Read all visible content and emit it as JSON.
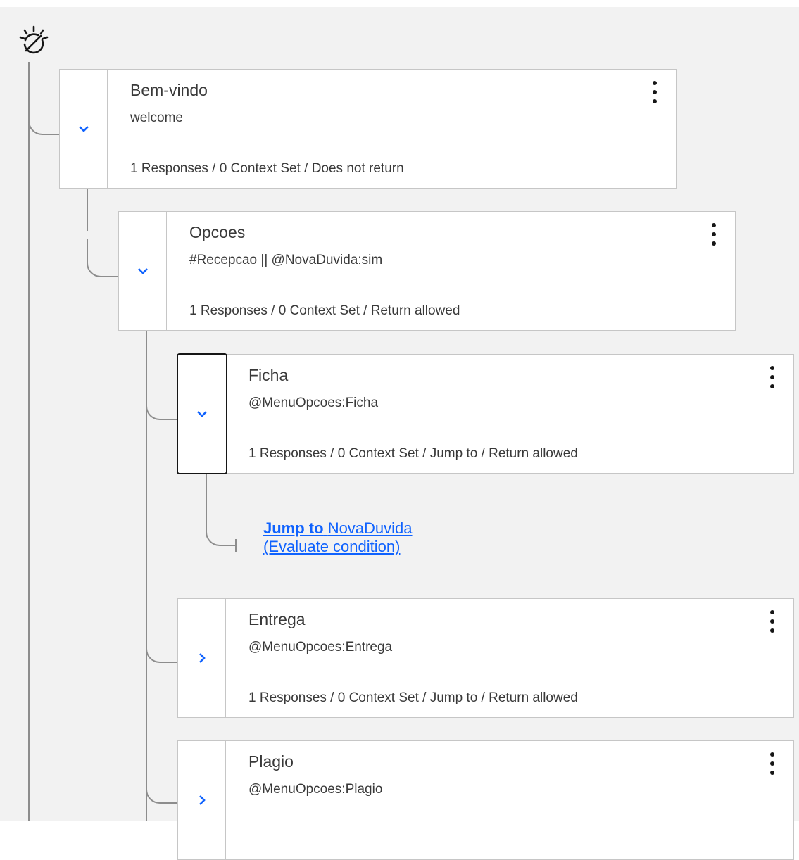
{
  "logo": {
    "icon": "watson-assistant-logo-icon"
  },
  "icons": {
    "expanded": "chevron-down-icon",
    "collapsed": "chevron-right-icon",
    "menu": "overflow-menu-icon"
  },
  "colors": {
    "accent": "#0f62fe",
    "connector": "#8d8d8d",
    "background": "#f2f2f2"
  },
  "nodes": [
    {
      "title": "Bem-vindo",
      "condition": "welcome",
      "summary": "1 Responses / 0 Context Set / Does not return",
      "expanded": true
    },
    {
      "title": "Opcoes",
      "condition": "#Recepcao || @NovaDuvida:sim",
      "summary": "1 Responses / 0 Context Set / Return allowed",
      "expanded": true
    },
    {
      "title": "Ficha",
      "condition": "@MenuOpcoes:Ficha",
      "summary": "1 Responses / 0 Context Set / Jump to / Return allowed",
      "expanded": true
    },
    {
      "title": "Entrega",
      "condition": "@MenuOpcoes:Entrega",
      "summary": "1 Responses / 0 Context Set / Jump to / Return allowed",
      "expanded": false
    },
    {
      "title": "Plagio",
      "condition": "@MenuOpcoes:Plagio",
      "summary": "",
      "expanded": false
    }
  ],
  "jump": {
    "prefix": "Jump to",
    "target": "NovaDuvida",
    "mode": "(Evaluate condition)"
  }
}
